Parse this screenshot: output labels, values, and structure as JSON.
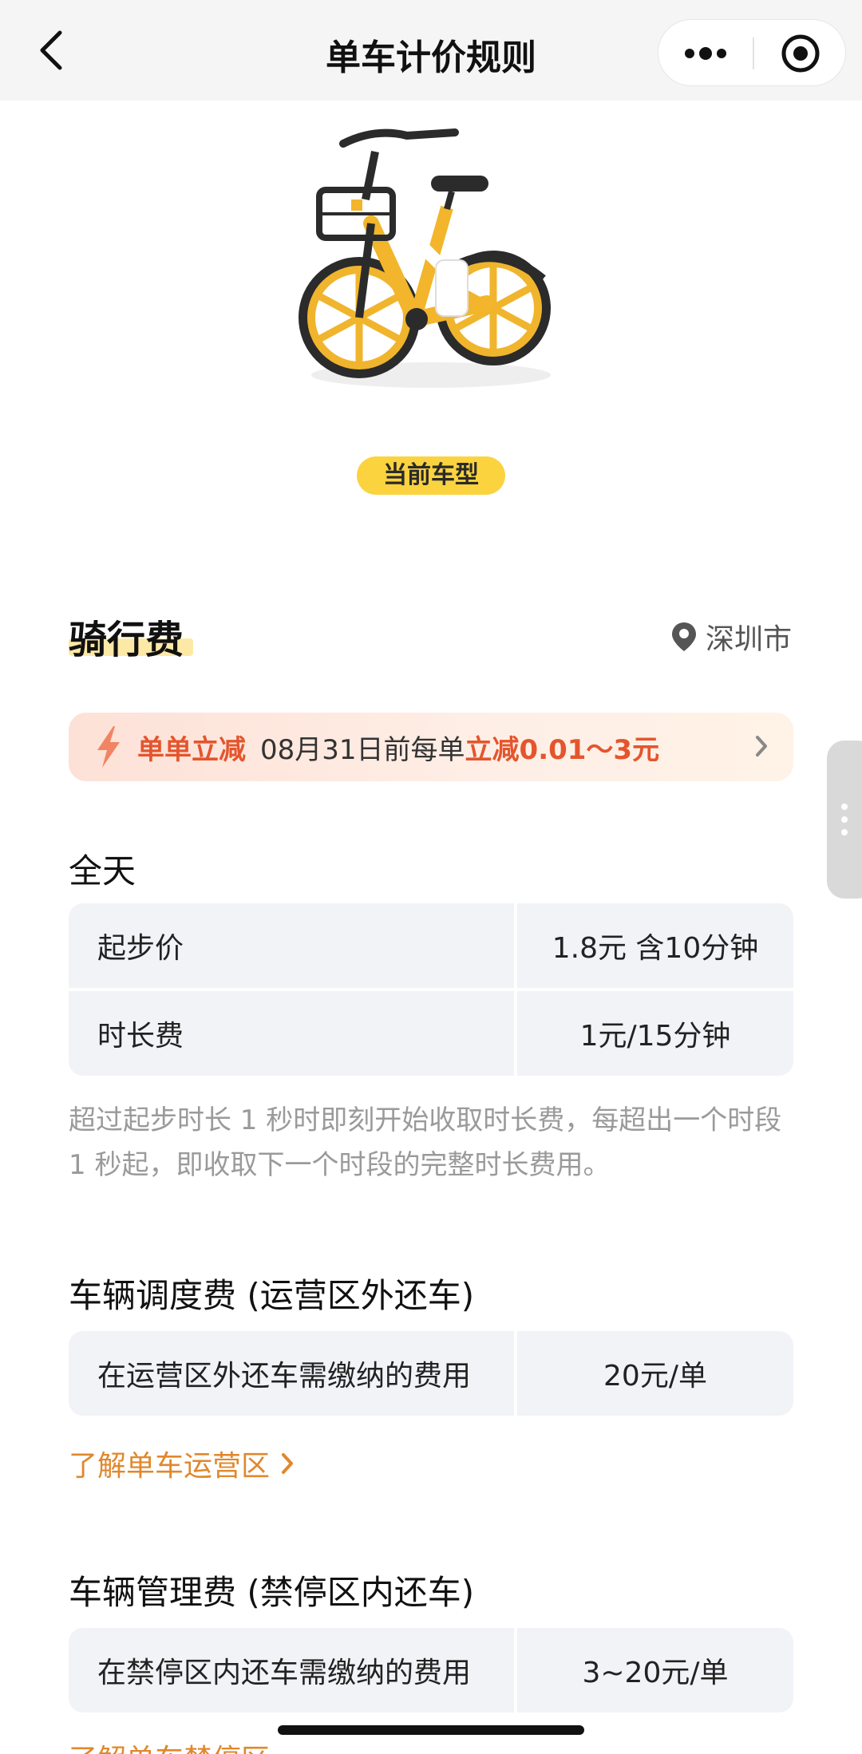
{
  "navbar": {
    "title": "单车计价规则",
    "back_icon": "chevron-left-icon",
    "more_icon": "more-dots-icon",
    "close_icon": "target-circle-icon"
  },
  "bike": {
    "current_tag": "当前车型"
  },
  "ride_fee": {
    "title": "骑行费",
    "city": "深圳市",
    "promo": {
      "tag": "单单立减",
      "text": "08月31日前每单",
      "highlight": "立减0.01～3元"
    },
    "period": "全天",
    "rows": [
      {
        "label": "起步价",
        "value": "1.8元 含10分钟"
      },
      {
        "label": "时长费",
        "value": "1元/15分钟"
      }
    ],
    "note": "超过起步时长 1 秒时即刻开始收取时长费，每超出一个时段 1 秒起，即收取下一个时段的完整时长费用。"
  },
  "dispatch_fee": {
    "title": "车辆调度费 (运营区外还车)",
    "rows": [
      {
        "label": "在运营区外还车需缴纳的费用",
        "value": "20元/单"
      }
    ],
    "link": "了解单车运营区"
  },
  "management_fee": {
    "title": "车辆管理费 (禁停区内还车)",
    "rows": [
      {
        "label": "在禁停区内还车需缴纳的费用",
        "value": "3~20元/单"
      }
    ],
    "link": "了解单车禁停区"
  },
  "colors": {
    "accent_yellow": "#fbd33f",
    "promo_red": "#e4552d",
    "link_orange": "#e0882d",
    "table_bg": "#f2f3f7"
  }
}
